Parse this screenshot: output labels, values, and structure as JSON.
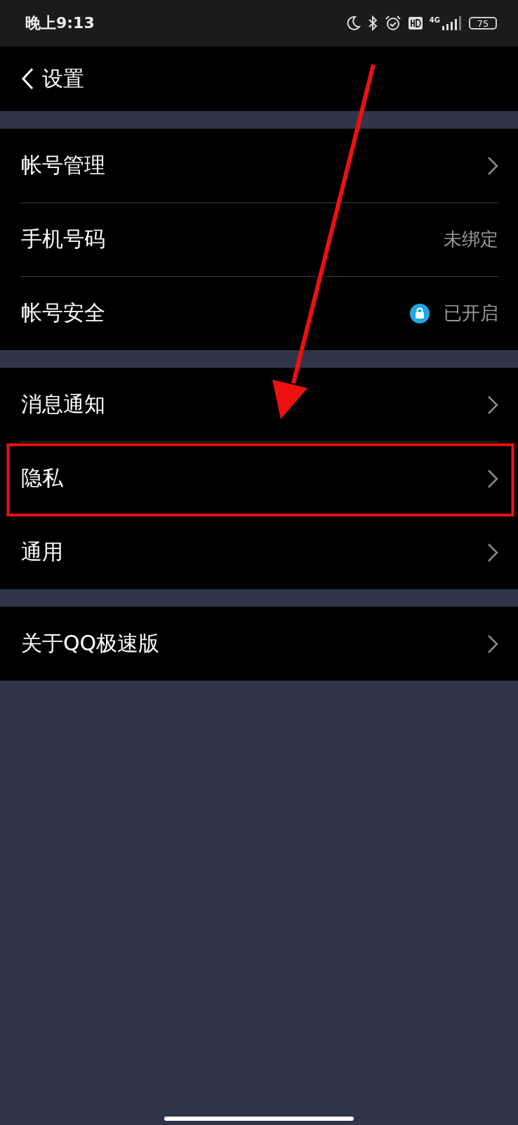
{
  "status_bar": {
    "time": "晚上9:13",
    "network": "4G",
    "battery": "75"
  },
  "nav": {
    "title": "设置"
  },
  "groups": [
    {
      "items": [
        {
          "label": "帐号管理",
          "kind": "chevron"
        },
        {
          "label": "手机号码",
          "kind": "value",
          "value": "未绑定"
        },
        {
          "label": "帐号安全",
          "kind": "secure_value",
          "value": "已开启"
        }
      ]
    },
    {
      "items": [
        {
          "label": "消息通知",
          "kind": "chevron"
        },
        {
          "label": "隐私",
          "kind": "chevron"
        },
        {
          "label": "通用",
          "kind": "chevron"
        }
      ]
    },
    {
      "items": [
        {
          "label": "关于QQ极速版",
          "kind": "chevron"
        }
      ]
    }
  ]
}
